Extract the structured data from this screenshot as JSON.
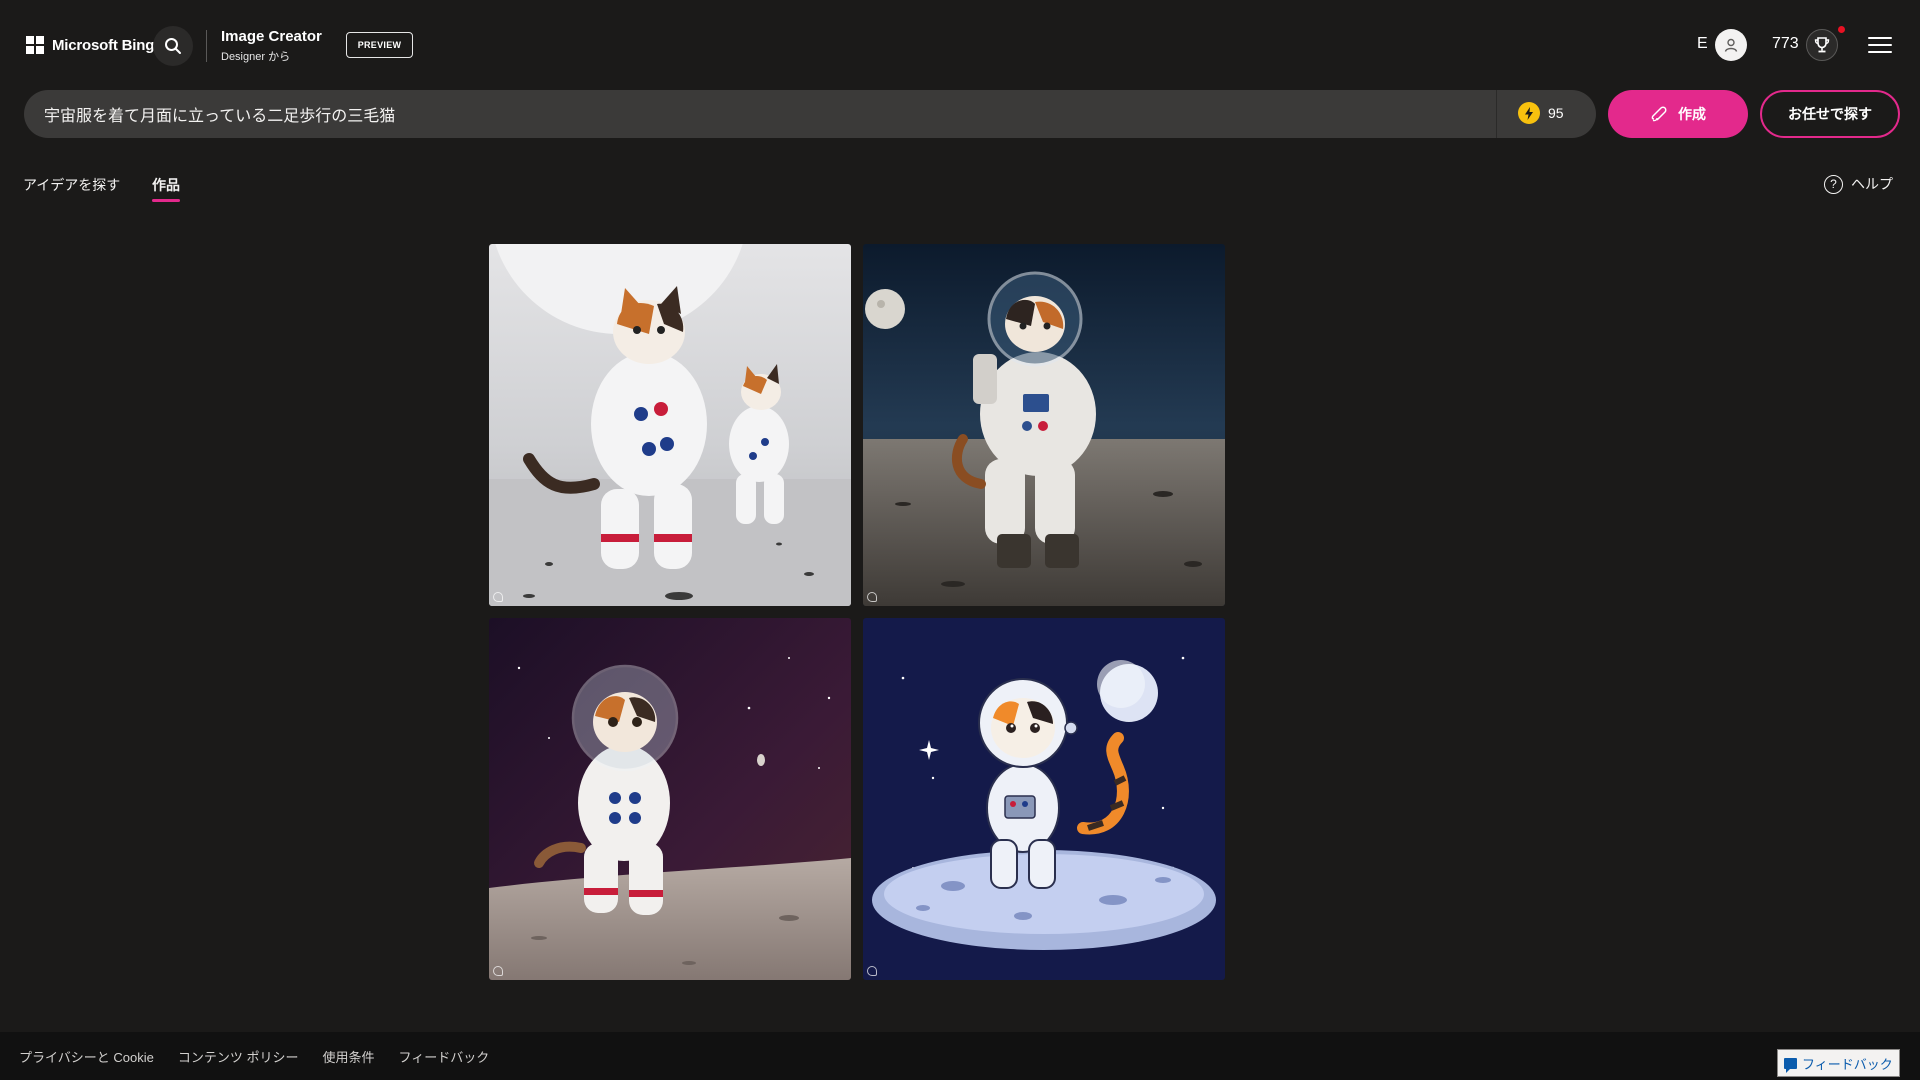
{
  "header": {
    "brand": "Microsoft Bing",
    "app_title": "Image Creator",
    "app_subtitle": "Designer から",
    "preview_badge": "PREVIEW",
    "user_initial": "E",
    "points": "773"
  },
  "prompt": {
    "value": "宇宙服を着て月面に立っている二足歩行の三毛猫",
    "boosts": "95",
    "create_label": "作成",
    "surprise_label": "お任せで探す"
  },
  "tabs": [
    {
      "label": "アイデアを探す",
      "active": false
    },
    {
      "label": "作品",
      "active": true
    }
  ],
  "help_label": "ヘルプ",
  "images": [
    {
      "icon": "calico-astronaut-cats-white-bg"
    },
    {
      "icon": "calico-astronaut-cat-moon-surface"
    },
    {
      "icon": "calico-astronaut-cat-helmet-space"
    },
    {
      "icon": "cartoon-calico-astronaut-cat"
    }
  ],
  "footer": {
    "links": [
      "プライバシーと Cookie",
      "コンテンツ ポリシー",
      "使用条件",
      "フィードバック"
    ],
    "feedback_button": "フィードバック"
  },
  "colors": {
    "accent": "#e3298c",
    "background": "#1b1a19",
    "boost_coin": "#f8c10e"
  }
}
